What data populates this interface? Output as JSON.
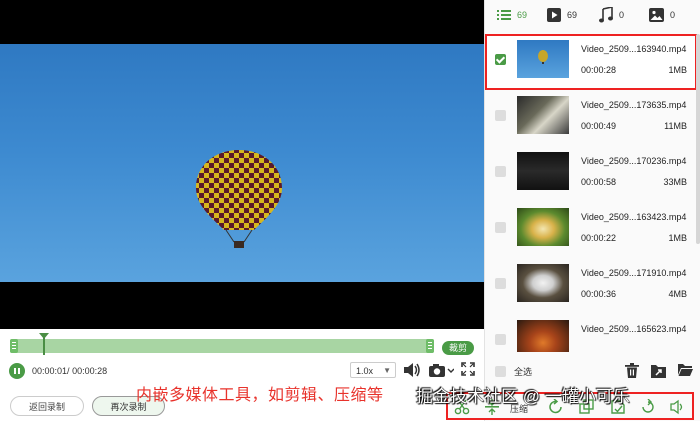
{
  "filters": {
    "all_count": "69",
    "video_count": "69",
    "audio_count": "0",
    "image_count": "0"
  },
  "player": {
    "current_time": "00:00:01",
    "total_time": "00:00:28",
    "separator": "/ ",
    "speed": "1.0x",
    "trim_label": "裁剪",
    "back_label": "返回录制",
    "rerecord_label": "再次录制"
  },
  "files": [
    {
      "name": "Video_2509...163940.mp4",
      "duration": "00:00:28",
      "size": "1MB",
      "checked": true
    },
    {
      "name": "Video_2509...173635.mp4",
      "duration": "00:00:49",
      "size": "11MB",
      "checked": false
    },
    {
      "name": "Video_2509...170236.mp4",
      "duration": "00:00:58",
      "size": "33MB",
      "checked": false
    },
    {
      "name": "Video_2509...163423.mp4",
      "duration": "00:00:22",
      "size": "1MB",
      "checked": false
    },
    {
      "name": "Video_2509...171910.mp4",
      "duration": "00:00:36",
      "size": "4MB",
      "checked": false
    },
    {
      "name": "Video_2509...165623.mp4",
      "duration": "",
      "size": "",
      "checked": false
    }
  ],
  "library": {
    "select_all_label": "全选",
    "compress_label": "压缩"
  },
  "overlay": {
    "caption": "内嵌多媒体工具，如剪辑、压缩等",
    "watermark": "掘金技术社区 @ 一罐小可乐"
  },
  "colors": {
    "accent": "#4a9b46",
    "highlight": "#e22222"
  }
}
